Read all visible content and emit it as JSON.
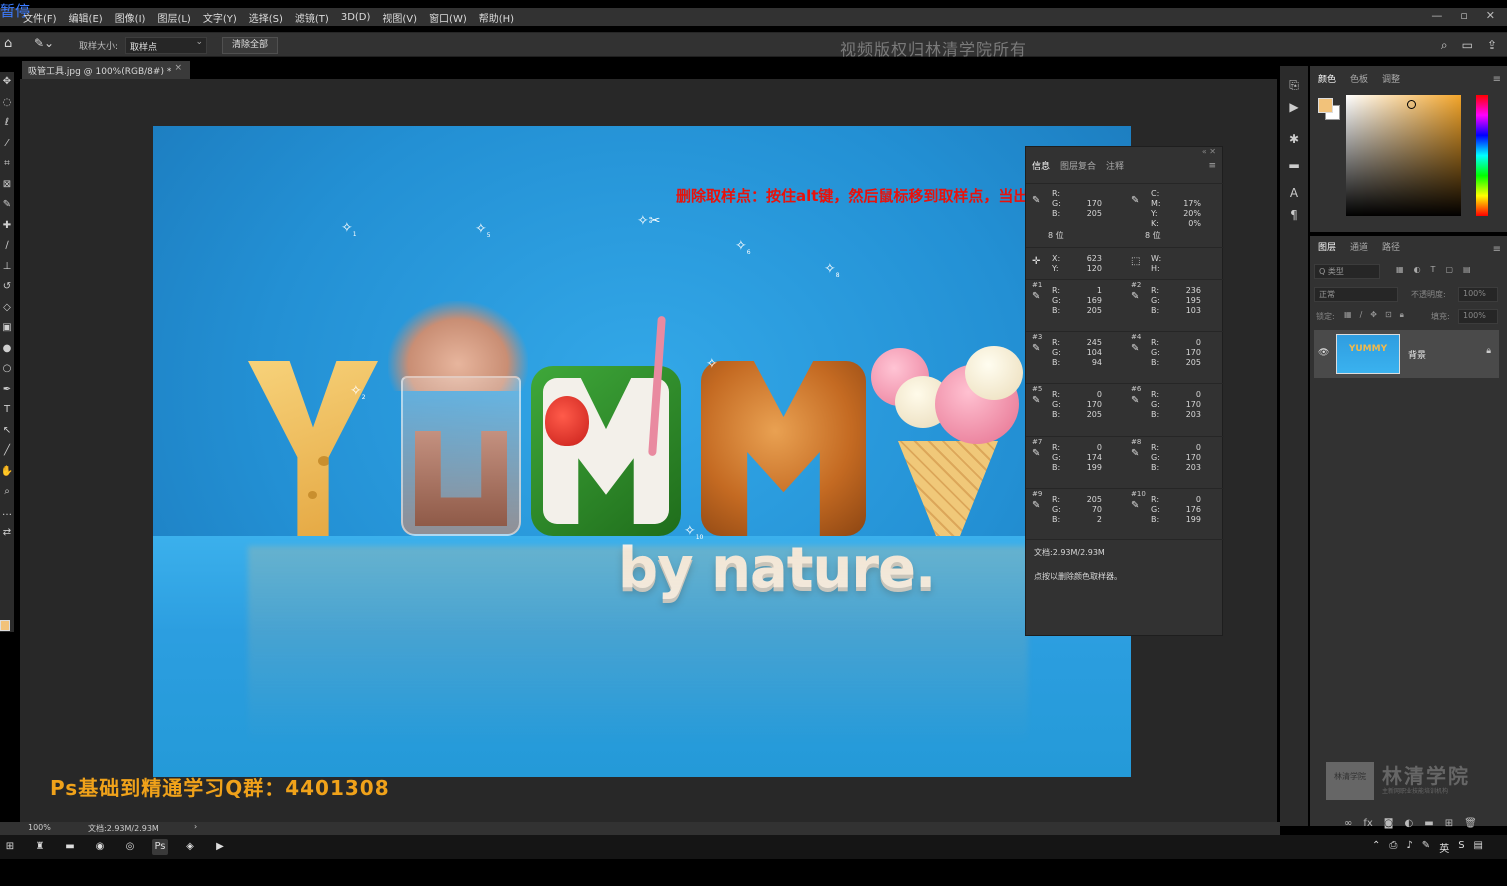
{
  "app": {
    "brand_glyph": "暂停",
    "menu": [
      "文件(F)",
      "编辑(E)",
      "图像(I)",
      "图层(L)",
      "文字(Y)",
      "选择(S)",
      "滤镜(T)",
      "3D(D)",
      "视图(V)",
      "窗口(W)",
      "帮助(H)"
    ],
    "window_controls": [
      "—",
      "▫",
      "✕"
    ]
  },
  "options_bar": {
    "sample_size_label": "取样大小:",
    "sample_size_value": "取样点",
    "clear_all_label": "清除全部",
    "copyright_watermark": "视频版权归林清学院所有"
  },
  "document": {
    "tab_title": "吸管工具.jpg @ 100%(RGB/8#) *",
    "tab_close": "×",
    "image_caption": "by nature.",
    "sampler_labels": [
      "1",
      "5",
      "6",
      "8",
      "2",
      "10"
    ]
  },
  "annotation": {
    "red_text": "删除取样点：按住alt键，然后鼠标移到取样点，当出现剪刀时松开即可去除",
    "qq_group": "Ps基础到精通学习Q群：4401308"
  },
  "info_panel": {
    "tabs": [
      "信息",
      "图层复合",
      "注释"
    ],
    "top_left": {
      "labels": [
        "R:",
        "G:",
        "B:"
      ],
      "values": [
        "",
        "170",
        "205"
      ],
      "bits": "8 位"
    },
    "top_right": {
      "labels": [
        "C:",
        "M:",
        "Y:",
        "K:"
      ],
      "values": [
        "",
        "17%",
        "20%",
        "0%"
      ],
      "bits": "8 位"
    },
    "xy": {
      "labels": [
        "X:",
        "Y:"
      ],
      "values": [
        "623",
        "120"
      ]
    },
    "wh": {
      "labels": [
        "W:",
        "H:"
      ],
      "values": [
        "",
        ""
      ]
    },
    "samplers": [
      {
        "num": "#1",
        "r": "1",
        "g": "169",
        "b": "205"
      },
      {
        "num": "#2",
        "r": "236",
        "g": "195",
        "b": "103"
      },
      {
        "num": "#3",
        "r": "245",
        "g": "104",
        "b": "94"
      },
      {
        "num": "#4",
        "r": "0",
        "g": "170",
        "b": "205"
      },
      {
        "num": "#5",
        "r": "0",
        "g": "170",
        "b": "205"
      },
      {
        "num": "#6",
        "r": "0",
        "g": "170",
        "b": "203"
      },
      {
        "num": "#7",
        "r": "0",
        "g": "174",
        "b": "199"
      },
      {
        "num": "#8",
        "r": "0",
        "g": "170",
        "b": "203"
      },
      {
        "num": "#9",
        "r": "205",
        "g": "70",
        "b": "2"
      },
      {
        "num": "#10",
        "r": "0",
        "g": "176",
        "b": "199"
      }
    ],
    "channel_labels": [
      "R:",
      "G:",
      "B:"
    ],
    "doc_size": "文档:2.93M/2.93M",
    "hint": "点按以删除颜色取样器。"
  },
  "color_panel": {
    "tabs": [
      "颜色",
      "色板",
      "调整"
    ],
    "foreground": "#f2c27a",
    "background": "#ffffff"
  },
  "layers_panel": {
    "tabs": [
      "图层",
      "通道",
      "路径"
    ],
    "filter_placeholder": "Q 类型",
    "blend_mode": "正常",
    "opacity_label": "不透明度:",
    "opacity_value": "100%",
    "lock_label": "锁定:",
    "fill_label": "填充:",
    "fill_value": "100%",
    "layer_name": "背景",
    "layer_thumb_text": "YUMMY"
  },
  "brand": {
    "name": "林清学院",
    "box_text": "林清学院",
    "sub": "主新网职业技能培训机构"
  },
  "statusbar": {
    "zoom": "100%",
    "doc": "文档:2.93M/2.93M",
    "arrow": "›"
  },
  "taskbar": {
    "input_method": "英"
  }
}
